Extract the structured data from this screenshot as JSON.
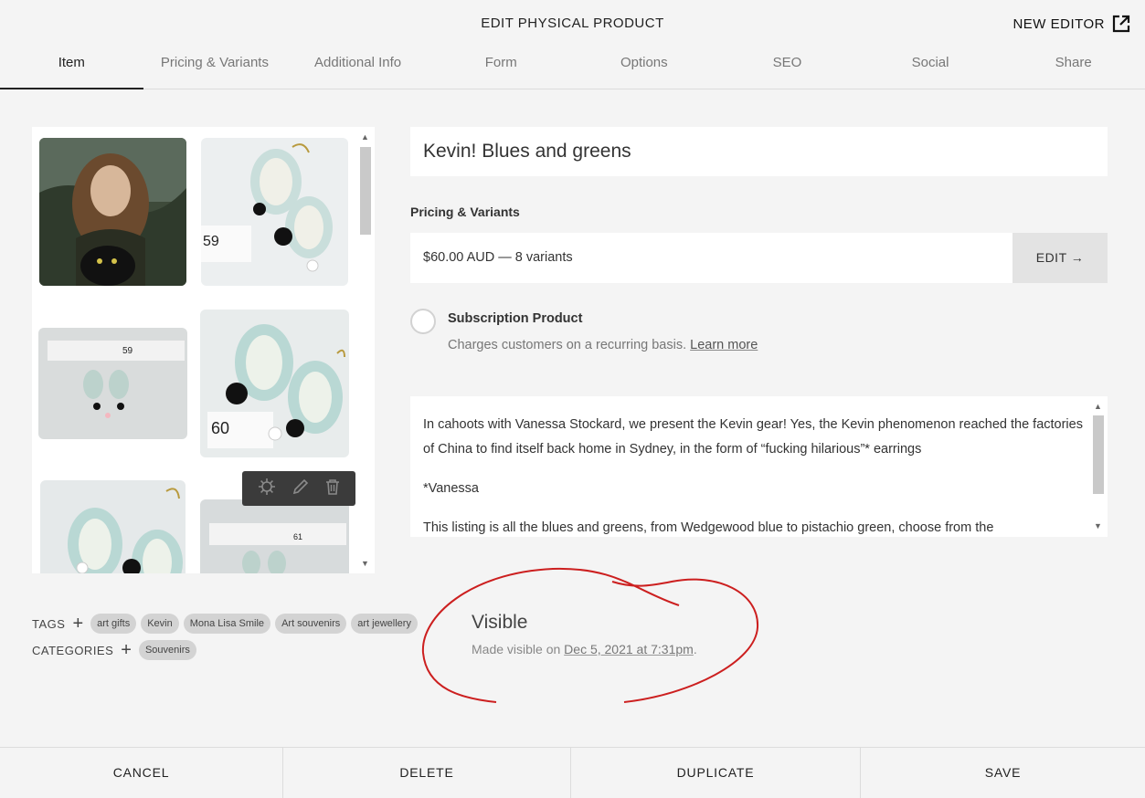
{
  "header": {
    "title": "EDIT PHYSICAL PRODUCT",
    "new_editor_label": "NEW EDITOR"
  },
  "tabs": [
    {
      "label": "Item"
    },
    {
      "label": "Pricing & Variants"
    },
    {
      "label": "Additional Info"
    },
    {
      "label": "Form"
    },
    {
      "label": "Options"
    },
    {
      "label": "SEO"
    },
    {
      "label": "Social"
    },
    {
      "label": "Share"
    }
  ],
  "gallery": {
    "thumb_labels": [
      "59",
      "59",
      "60",
      "61"
    ]
  },
  "product": {
    "title": "Kevin! Blues and greens",
    "pricing_label": "Pricing & Variants",
    "pricing_summary": "$60.00 AUD — 8 variants",
    "edit_label": "EDIT →",
    "subscription_title": "Subscription Product",
    "subscription_desc": "Charges customers on a recurring basis.",
    "learn_more": "Learn more",
    "description": [
      "In cahoots with Vanessa Stockard, we present the Kevin gear! Yes, the Kevin phenomenon reached the factories of China to find itself back home in Sydney, in the form of “fucking hilarious”* earrings",
      "*Vanessa",
      "This listing is all the blues and greens, from Wedgewood blue to pistachio green, choose from the"
    ]
  },
  "tags": {
    "label": "TAGS",
    "items": [
      "art gifts",
      "Kevin",
      "Mona Lisa Smile",
      "Art souvenirs",
      "art jewellery"
    ]
  },
  "categories": {
    "label": "CATEGORIES",
    "items": [
      "Souvenirs"
    ]
  },
  "visibility": {
    "status": "Visible",
    "prefix": "Made visible on",
    "date": "Dec 5, 2021 at 7:31pm",
    "suffix": "."
  },
  "footer": {
    "cancel": "CANCEL",
    "delete": "DELETE",
    "duplicate": "DUPLICATE",
    "save": "SAVE"
  },
  "colors": {
    "annotation": "#cc1f1f",
    "toolbar": "#3b3b3b",
    "background": "#f4f4f4"
  }
}
